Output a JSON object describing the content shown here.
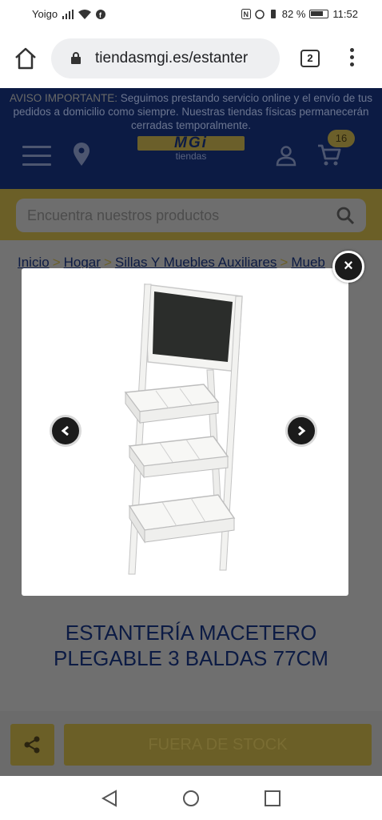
{
  "status_bar": {
    "carrier": "Yoigo",
    "battery": "82 %",
    "time": "11:52"
  },
  "browser": {
    "url": "tiendasmgi.es/estanter",
    "tab_count": "2"
  },
  "site": {
    "notice_highlight": "AVISO IMPORTANTE:",
    "notice_text": " Seguimos prestando servicio online y el envío de tus pedidos a domicilio como siempre. Nuestras tiendas físicas permanecerán cerradas temporalmente.",
    "logo_text": "MGi",
    "logo_sub": "tiendas",
    "cart_count": "16",
    "search_placeholder": "Encuentra nuestros productos"
  },
  "breadcrumb": [
    "Inicio",
    "Hogar",
    "Sillas Y Muebles Auxiliares",
    "Mueb"
  ],
  "breadcrumb_separator": ">",
  "product": {
    "title_line1": "ESTANTERÍA MACETERO",
    "title_line2": "PLEGABLE 3 BALDAS 77CM",
    "stock_label": "FUERA DE STOCK"
  },
  "lightbox": {
    "close_label": "×",
    "image_alt": "Estantería macetero plegable blanca con pizarra"
  },
  "colors": {
    "navy": "#0c1b44",
    "gold": "#ecd64e",
    "overlay_dim": "rgba(0,0,0,0.56)"
  }
}
